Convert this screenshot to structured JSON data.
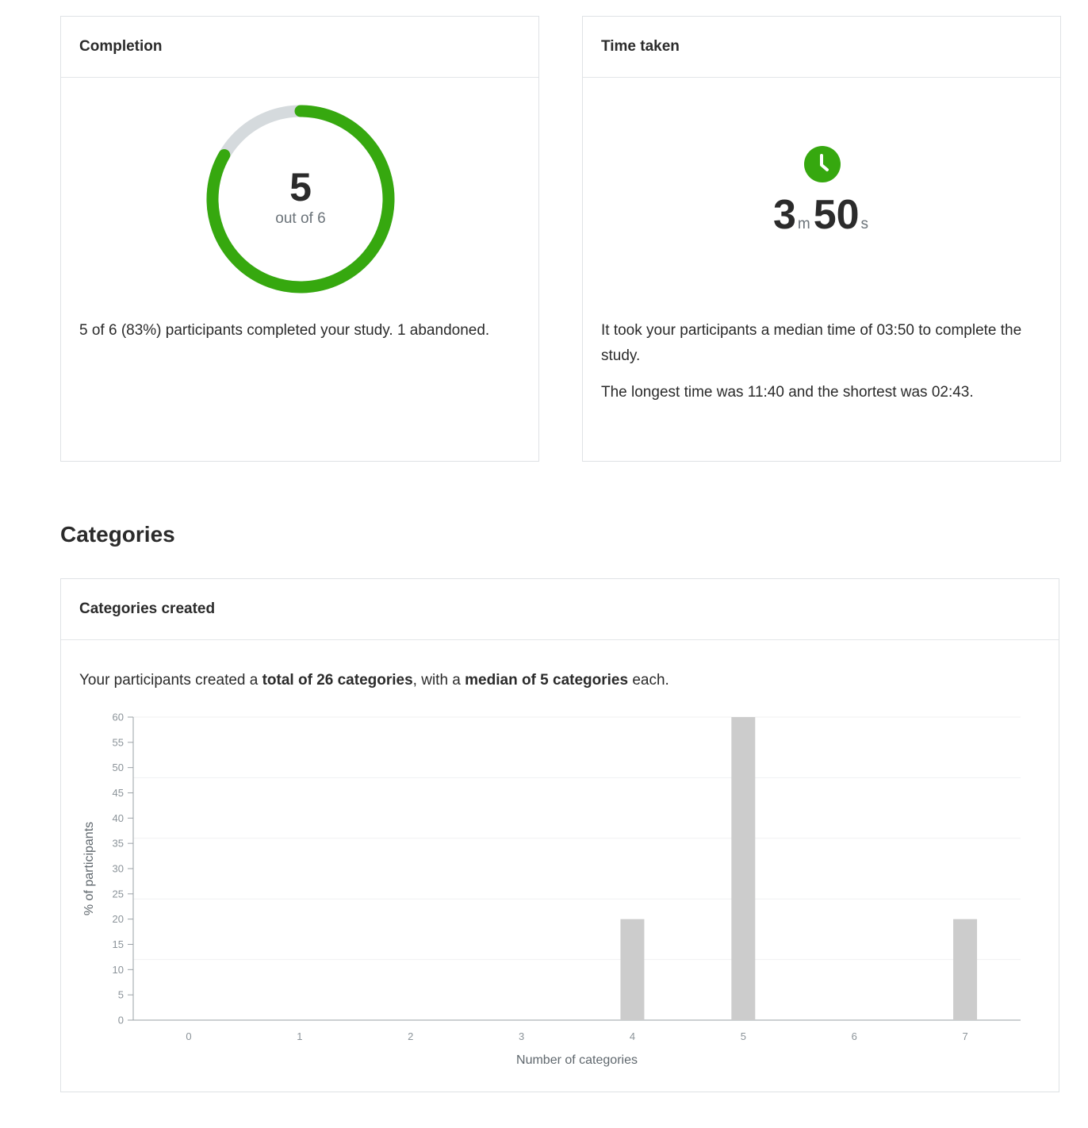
{
  "completion": {
    "title": "Completion",
    "completed": 5,
    "total": 6,
    "center_number": "5",
    "center_sub": "out of 6",
    "fraction": 0.8333,
    "colors": {
      "progress": "#36a80f",
      "track": "#d5dadd"
    },
    "summary": "5 of 6 (83%) participants completed your study. 1 abandoned."
  },
  "time_taken": {
    "title": "Time taken",
    "icon": "clock-icon",
    "minutes": "3",
    "minutes_unit": "m",
    "seconds": "50",
    "seconds_unit": "s",
    "median_text": "It took your participants a median time of 03:50 to complete the study.",
    "range_text": "The longest time was 11:40 and the shortest was 02:43.",
    "icon_color": "#36a80f"
  },
  "categories_section": {
    "title": "Categories"
  },
  "categories_created": {
    "title": "Categories created",
    "summary_prefix": "Your participants created a ",
    "summary_total": "total of 26 categories",
    "summary_middle": ", with a ",
    "summary_median": "median of 5 categories",
    "summary_suffix": " each."
  },
  "chart_data": {
    "type": "bar",
    "categories": [
      "0",
      "1",
      "2",
      "3",
      "4",
      "5",
      "6",
      "7"
    ],
    "values": [
      0,
      0,
      0,
      0,
      20,
      60,
      0,
      20
    ],
    "title": "",
    "xlabel": "Number of categories",
    "ylabel": "% of participants",
    "ylim": [
      0,
      60
    ],
    "yticks": [
      0,
      5,
      10,
      15,
      20,
      25,
      30,
      35,
      40,
      45,
      50,
      55,
      60
    ],
    "grid": true,
    "bar_color": "#cccccc"
  }
}
